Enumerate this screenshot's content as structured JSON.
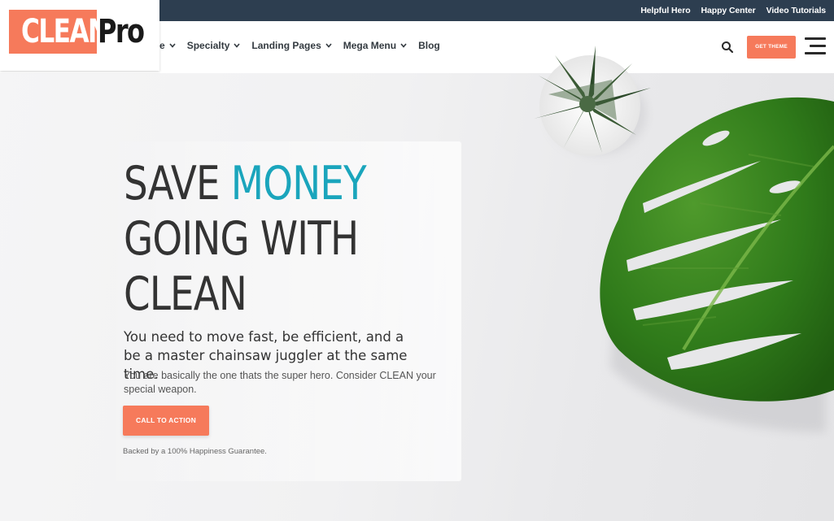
{
  "topbar": {
    "links": [
      "Helpful Hero",
      "Happy Center",
      "Video Tutorials"
    ]
  },
  "logo": {
    "clean_text": "CLEAN",
    "pro_text": "Pro"
  },
  "nav": {
    "items": [
      {
        "label": "e",
        "has_dropdown": true
      },
      {
        "label": "Specialty",
        "has_dropdown": true
      },
      {
        "label": "Landing Pages",
        "has_dropdown": true
      },
      {
        "label": "Mega Menu",
        "has_dropdown": true
      },
      {
        "label": "Blog",
        "has_dropdown": false
      }
    ],
    "get_theme_label": "GET THEME",
    "search_icon": "search-icon",
    "menu_icon": "hamburger-icon"
  },
  "hero": {
    "headline_line1_plain": "SAVE ",
    "headline_line1_accent": "MONEY",
    "headline_line2": "GOING WITH",
    "headline_line3": "CLEAN",
    "subhead": "You need to move fast, be efficient, and a be a master chainsaw juggler at the same time.",
    "body": "You are basically the one thats the super hero. Consider CLEAN your special weapon.",
    "cta_label": "CALL TO ACTION",
    "guarantee": "Backed by a 100% Happiness Guarantee."
  },
  "colors": {
    "accent": "#f67a5b",
    "teal": "#1aa5bc",
    "topbar": "#2d3e50"
  }
}
